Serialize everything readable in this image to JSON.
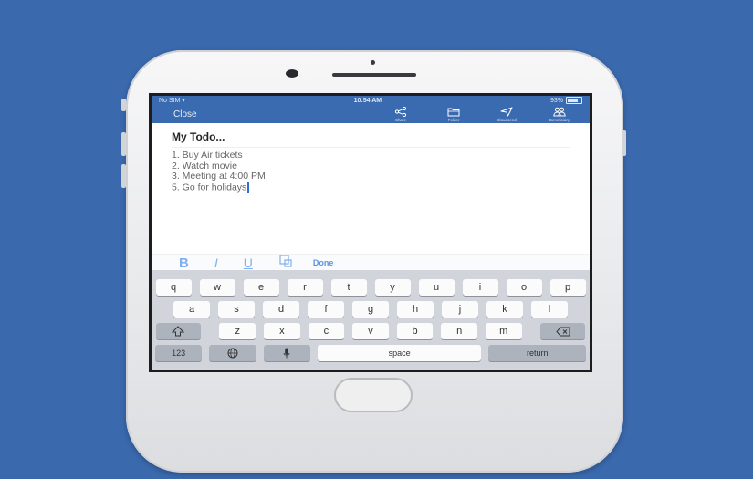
{
  "status_bar": {
    "carrier": "No SIM",
    "time": "10:54 AM",
    "battery": "93%"
  },
  "nav": {
    "close_label": "Close",
    "tools": [
      {
        "label": "Share",
        "icon": "share-icon"
      },
      {
        "label": "Folder",
        "icon": "folder-icon"
      },
      {
        "label": "Cloudsend",
        "icon": "send-icon"
      },
      {
        "label": "Beneficiary",
        "icon": "people-icon"
      }
    ]
  },
  "note": {
    "title": "My Todo...",
    "items": [
      "1. Buy Air tickets",
      "2. Watch movie",
      "3. Meeting at 4:00 PM",
      "5. Go for holidays"
    ]
  },
  "format_bar": {
    "bold": "B",
    "italic": "I",
    "underline": "U",
    "done": "Done"
  },
  "keyboard": {
    "row1": [
      "q",
      "w",
      "e",
      "r",
      "t",
      "y",
      "u",
      "i",
      "o",
      "p"
    ],
    "row2": [
      "a",
      "s",
      "d",
      "f",
      "g",
      "h",
      "j",
      "k",
      "l"
    ],
    "row3": [
      "z",
      "x",
      "c",
      "v",
      "b",
      "n",
      "m"
    ],
    "numbers_label": "123",
    "space_label": "space",
    "return_label": "return"
  },
  "colors": {
    "background": "#3a69ad",
    "nav": "#3a6ab0",
    "accent": "#5b93e2"
  }
}
